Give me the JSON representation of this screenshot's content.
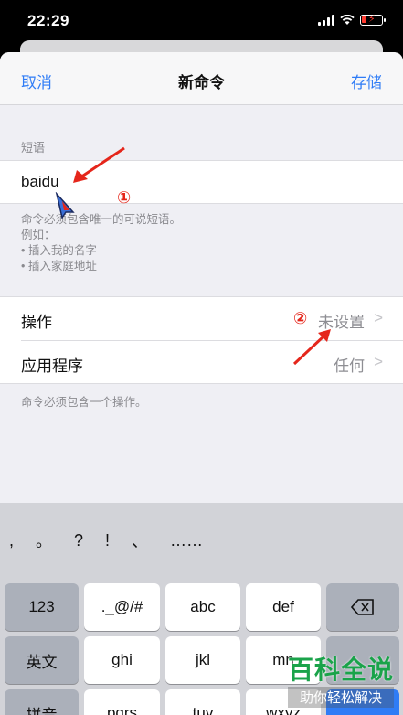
{
  "status": {
    "time": "22:29"
  },
  "nav": {
    "cancel": "取消",
    "title": "新命令",
    "save": "存储"
  },
  "phrase": {
    "section_label": "短语",
    "value": "baidu",
    "help_lines": [
      "命令必须包含唯一的可说短语。",
      "例如：",
      "• 插入我的名字",
      "• 插入家庭地址"
    ]
  },
  "settings": [
    {
      "label": "操作",
      "value": "未设置",
      "chevron": ">"
    },
    {
      "label": "应用程序",
      "value": "任何",
      "chevron": ">"
    }
  ],
  "footnote": "命令必须包含一个操作。",
  "annotations": {
    "one": "①",
    "two": "②",
    "color": "#e5261b"
  },
  "keyboard": {
    "candidates": [
      ",",
      "。",
      "?",
      "!",
      "、",
      "……"
    ],
    "row1": [
      "123",
      "._@/#",
      "abc",
      "def",
      "delete-icon"
    ],
    "row2": [
      "英文",
      "ghi",
      "jkl",
      "mn"
    ],
    "row3": [
      "拼音",
      "pqrs",
      "tuv",
      "wxyz"
    ]
  },
  "watermark": {
    "title": "百科全说",
    "subtitle": "助你轻松解决"
  },
  "colors": {
    "accent": "#2f7cf6",
    "annotation": "#e5261b",
    "watermark": "#1aa34a"
  }
}
